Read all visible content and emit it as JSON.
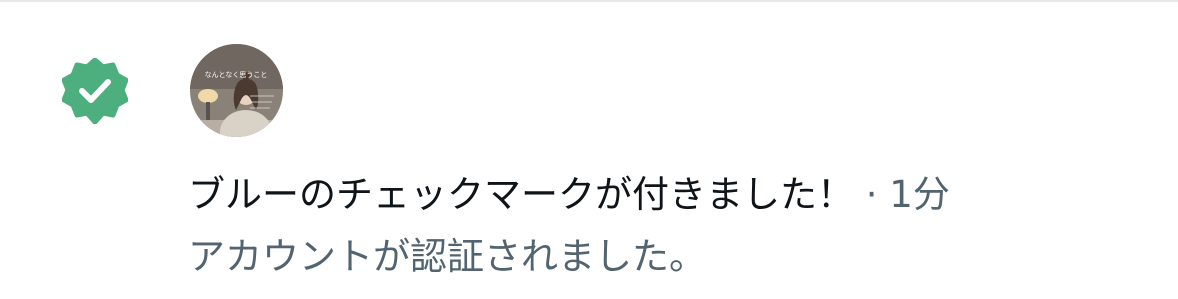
{
  "notification": {
    "title": "ブルーのチェックマークが付きました！",
    "separator": "·",
    "timestamp": "1分",
    "body": "アカウントが認証されました。",
    "icon": "verified-badge-icon",
    "avatar": "user-avatar",
    "avatar_text": "なんとなく思うこと"
  },
  "colors": {
    "badge": "#4caf7d",
    "primary_text": "#0f1419",
    "secondary_text": "#536471",
    "divider": "#e7e9ea"
  }
}
